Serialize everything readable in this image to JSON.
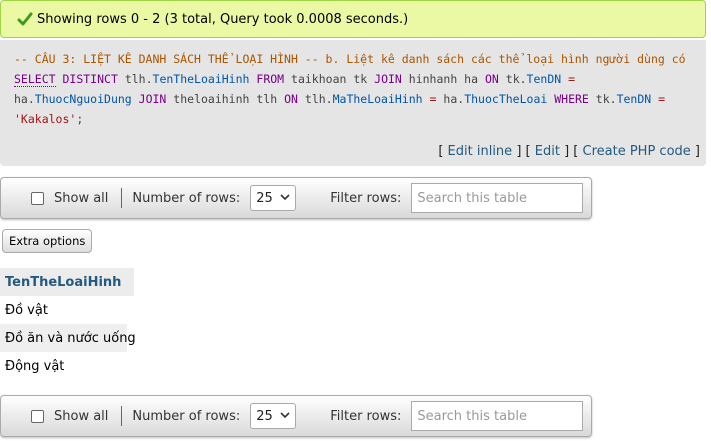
{
  "success": {
    "message": "Showing rows 0 - 2 (3 total, Query took 0.0008 seconds.)",
    "icon": "check-icon"
  },
  "sql": {
    "comment": "-- CÂU 3: LIỆT KÊ DANH SÁCH THỂ LOẠI HÌNH -- b. Liệt kê danh sách các thể loại hình người dùng có",
    "t_select": "SELECT",
    "t_distinct": "DISTINCT",
    "t_tlh1": "tlh.",
    "t_col1": "TenTheLoaiHinh",
    "t_from": "FROM",
    "t_tbl1": "taikhoan tk",
    "t_join1": "JOIN",
    "t_tbl2": "hinhanh ha",
    "t_on1": "ON",
    "t_tk1": "tk.",
    "t_col2": "TenDN",
    "t_eq1": "=",
    "t_ha1": "ha.",
    "t_col3": "ThuocNguoiDung",
    "t_join2": "JOIN",
    "t_tbl3": "theloaihinh tlh",
    "t_on2": "ON",
    "t_tlh2": "tlh.",
    "t_col4": "MaTheLoaiHinh",
    "t_eq2": "=",
    "t_ha2": "ha.",
    "t_col5": "ThuocTheLoai",
    "t_where": "WHERE",
    "t_tk2": "tk.",
    "t_col6": "TenDN",
    "t_eq3": "=",
    "t_str": "'Kakalos'",
    "t_end": ";",
    "links": {
      "open1": "[",
      "edit_inline": "Edit inline",
      "close1": "]",
      "open2": "[",
      "edit": "Edit",
      "close2": "]",
      "open3": "[",
      "create_php": "Create PHP code",
      "close3": "]"
    }
  },
  "nav": {
    "show_all": "Show all",
    "number_of_rows_label": "Number of rows:",
    "rows_value": "25",
    "filter_label": "Filter rows:",
    "search_placeholder": "Search this table"
  },
  "extra_options": "Extra options",
  "table": {
    "header": "TenTheLoaiHinh",
    "rows": [
      "Đồ vật",
      "Đồ ăn và nước uống",
      "Động vật"
    ]
  }
}
